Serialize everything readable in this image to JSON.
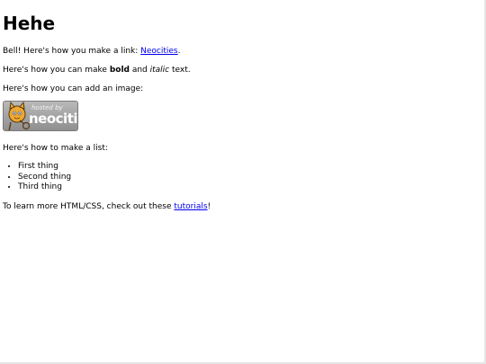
{
  "heading": "Hehe",
  "intro": {
    "text": "Bell! Here's how you make a link: ",
    "link_text": "Neocities",
    "after": "."
  },
  "formatting": {
    "before": "Here's how you can make ",
    "bold": "bold",
    "middle": " and ",
    "italic": "italic",
    "after": " text."
  },
  "image_line": "Here's how you can add an image:",
  "badge": {
    "small_text": "hosted by",
    "brand_text": "neocities",
    "colors": {
      "bg": "#9e9e9e",
      "cat": "#f0a830",
      "text": "#ffffff"
    }
  },
  "list_line": "Here's how to make a list:",
  "list_items": [
    "First thing",
    "Second thing",
    "Third thing"
  ],
  "outro": {
    "before": "To learn more HTML/CSS, check out these ",
    "link_text": "tutorials",
    "after": "!"
  }
}
